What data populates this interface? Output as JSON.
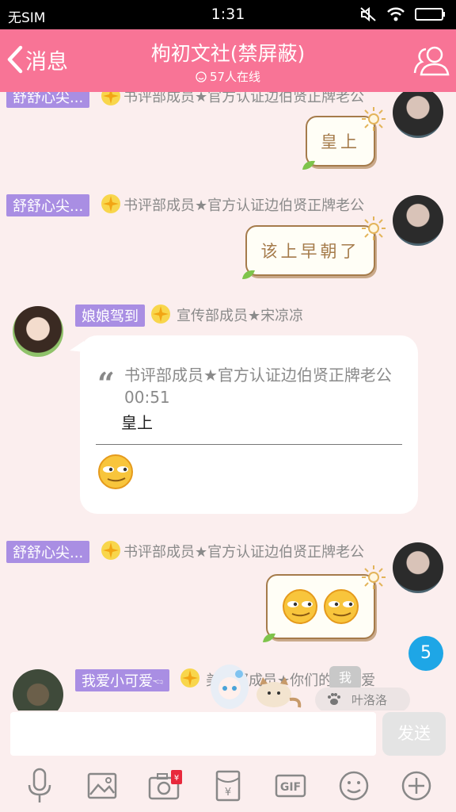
{
  "status_bar": {
    "carrier": "无SIM",
    "time": "1:31"
  },
  "header": {
    "back_label": "消息",
    "title": "枸初文社(禁屏蔽)",
    "online": "57人在线"
  },
  "messages": [
    {
      "sender": "舒舒心尖...",
      "title": "书评部成员★官方认证边伯贤正牌老公",
      "text": "皇上",
      "side": "right"
    },
    {
      "sender": "舒舒心尖...",
      "title": "书评部成员★官方认证边伯贤正牌老公",
      "text": "该上早朝了",
      "side": "right"
    },
    {
      "sender": "娘娘驾到",
      "title": "宣传部成员★宋凉凉",
      "quote": "书评部成员★官方认证边伯贤正牌老公 00:51",
      "reply": "皇上",
      "side": "left"
    },
    {
      "sender": "舒舒心尖...",
      "title": "书评部成员★官方认证边伯贤正牌老公",
      "side": "right"
    },
    {
      "sender": "我爱小可爱🖘",
      "title": "美工部成员★你们的小可爱",
      "side": "left"
    }
  ],
  "unread_count": "5",
  "typing_user": "叶洛洛",
  "me_chip": "我",
  "input": {
    "placeholder": "",
    "send_label": "发送"
  },
  "toolbar": [
    "mic-icon",
    "image-icon",
    "camera-icon",
    "red-packet-icon",
    "gif-icon",
    "emoji-icon",
    "plus-icon"
  ],
  "gif_label": "GIF",
  "colors": {
    "header": "#f87496",
    "name_tag": "#a98ee3",
    "unread": "#1ea6e6",
    "bubble_border": "#a57b4b"
  }
}
